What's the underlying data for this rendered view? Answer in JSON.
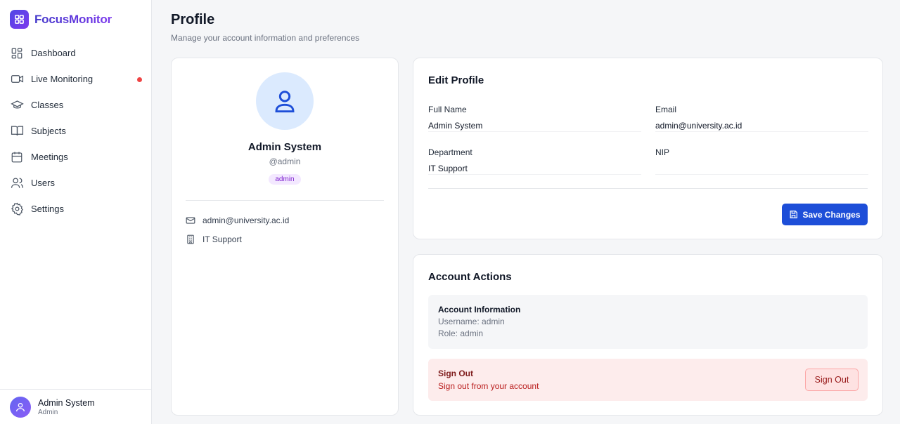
{
  "app": {
    "name": "FocusMonitor"
  },
  "sidebar": {
    "items": [
      {
        "label": "Dashboard",
        "icon": "dashboard-grid-icon"
      },
      {
        "label": "Live Monitoring",
        "icon": "video-camera-icon",
        "indicator": "live"
      },
      {
        "label": "Classes",
        "icon": "graduation-cap-icon"
      },
      {
        "label": "Subjects",
        "icon": "book-open-icon"
      },
      {
        "label": "Meetings",
        "icon": "calendar-icon"
      },
      {
        "label": "Users",
        "icon": "users-icon"
      },
      {
        "label": "Settings",
        "icon": "gear-icon"
      }
    ],
    "user": {
      "name": "Admin System",
      "role": "Admin"
    }
  },
  "header": {
    "title": "Profile",
    "subtitle": "Manage your account information and preferences"
  },
  "profile": {
    "name": "Admin System",
    "handle": "@admin",
    "badge": "admin",
    "email": "admin@university.ac.id",
    "department": "IT Support"
  },
  "edit_profile": {
    "title": "Edit Profile",
    "full_name_label": "Full Name",
    "full_name_value": "Admin System",
    "email_label": "Email",
    "email_value": "admin@university.ac.id",
    "department_label": "Department",
    "department_value": "IT Support",
    "nip_label": "NIP",
    "nip_value": "",
    "save_label": "Save Changes"
  },
  "account_actions": {
    "title": "Account Actions",
    "info_title": "Account Information",
    "username_line": "Username: admin",
    "role_line": "Role: admin",
    "signout_title": "Sign Out",
    "signout_desc": "Sign out from your account",
    "signout_button": "Sign Out"
  },
  "colors": {
    "accent": "#1d4ed8",
    "brand_start": "#4f46e5",
    "brand_end": "#7c3aed",
    "live_indicator": "#ef4444",
    "danger_bg": "#fdecec"
  }
}
